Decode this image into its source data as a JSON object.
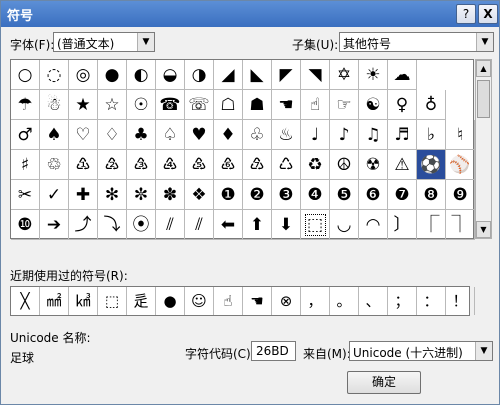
{
  "window": {
    "title": "符号",
    "help": "?",
    "close": "X"
  },
  "font": {
    "label": "字体(F):",
    "value": "(普通文本)"
  },
  "subset": {
    "label": "子集(U):",
    "value": "其他符号"
  },
  "symbols": [
    [
      "○",
      "◌",
      "◎",
      "●",
      "◐",
      "◒",
      "◑",
      "◢",
      "◣",
      "◤",
      "◥",
      "✡",
      "☀",
      "☁"
    ],
    [
      "☂",
      "☃",
      "★",
      "☆",
      "☉",
      "☎",
      "☏",
      "☖",
      "☗",
      "☚",
      "☝",
      "☞",
      "☯",
      "♀",
      "♁"
    ],
    [
      "♂",
      "♠",
      "♡",
      "♢",
      "♣",
      "♤",
      "♥",
      "♦",
      "♧",
      "♨",
      "♩",
      "♪",
      "♫",
      "♬",
      "♭",
      "♮"
    ],
    [
      "♯",
      "♲",
      "♳",
      "♴",
      "♵",
      "♶",
      "♷",
      "♸",
      "♹",
      "♺",
      "♻",
      "☮",
      "☢",
      "⚠",
      "⚽",
      "⚾"
    ],
    [
      "✂",
      "✓",
      "✚",
      "✻",
      "✼",
      "✽",
      "❖",
      "❶",
      "❷",
      "❸",
      "❹",
      "❺",
      "❻",
      "❼",
      "❽",
      "❾"
    ],
    [
      "❿",
      "➔",
      "⤴",
      "⤵",
      "⦿",
      "⫽",
      "⫽",
      "⬅",
      "⬆",
      "⬇",
      "⬚",
      "◡",
      "◠",
      "〕",
      "⎾",
      "⏋"
    ]
  ],
  "recent": {
    "label": "近期使用过的符号(R):",
    "items": [
      "╳",
      "㎟",
      "㎦",
      "⬚",
      "辵",
      "●",
      "☺",
      "☝",
      "☚",
      "⊗",
      "，",
      "。",
      "、",
      "；",
      "：",
      "！"
    ]
  },
  "unicode": {
    "label": "Unicode 名称:",
    "name": "足球"
  },
  "charcode": {
    "label": "字符代码(C):",
    "value": "26BD"
  },
  "from": {
    "label": "来自(M):",
    "value": "Unicode (十六进制)"
  },
  "ok_button": "确定"
}
